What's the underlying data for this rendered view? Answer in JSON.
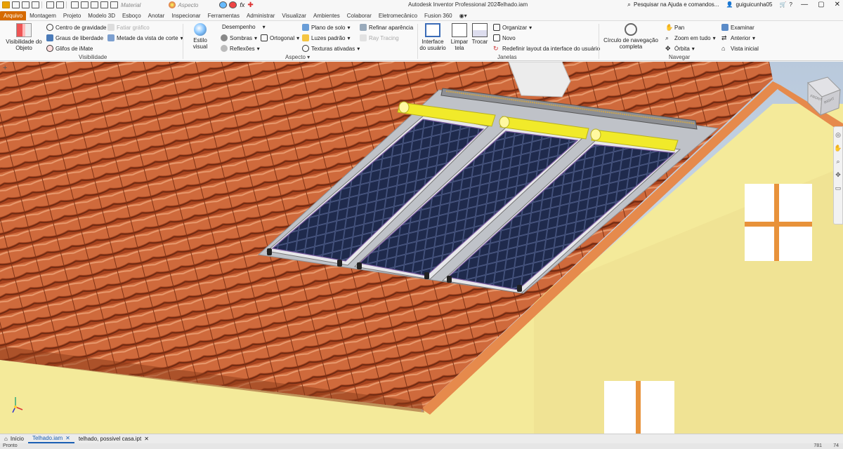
{
  "titlebar": {
    "material_placeholder": "Material",
    "appearance_placeholder": "Aspecto",
    "app_title": "Autodesk Inventor Professional 2024",
    "file_name": "Telhado.iam",
    "search_text": "Pesquisar na Ajuda e comandos...",
    "user_name": "guiguicunha05"
  },
  "tabs": [
    "Arquivo",
    "Montagem",
    "Projeto",
    "Modelo 3D",
    "Esboço",
    "Anotar",
    "Inspecionar",
    "Ferramentas",
    "Administrar",
    "Visualizar",
    "Ambientes",
    "Colaborar",
    "Eletromecânico",
    "Fusion 360"
  ],
  "ribbon": {
    "visibilidade": {
      "object_visibility": "Visibilidade do Objeto",
      "centro_gravidade": "Centro de gravidade",
      "graus_liberdade": "Graus de liberdade",
      "glifos_imate": "Glifos de iMate",
      "fatiar_grafico": "Fatiar gráfico",
      "metade_vista": "Metade da vista de corte",
      "label": "Visibilidade"
    },
    "aspecto": {
      "estilo_visual": "Estilo visual",
      "desempenho": "Desempenho",
      "sombras": "Sombras",
      "reflexoes": "Reflexões",
      "ortogonal": "Ortogonal",
      "plano_solo": "Plano de solo",
      "luzes_padrao": "Luzes padrão",
      "texturas_ativadas": "Texturas ativadas",
      "refinar_aparencia": "Refinar aparência",
      "ray_tracing": "Ray Tracing",
      "label": "Aspecto"
    },
    "janelas": {
      "interface_usuario": "Interface do usuário",
      "limpar_tela": "Limpar tela",
      "trocar": "Trocar",
      "organizar": "Organizar",
      "novo": "Novo",
      "redefinir_layout": "Redefinir layout da interface do usuário",
      "label": "Janelas"
    },
    "navegar": {
      "circulo_navegacao": "Círculo de navegação completa",
      "pan": "Pan",
      "zoom_tudo": "Zoom em tudo",
      "orbita": "Órbita",
      "examinar": "Examinar",
      "anterior": "Anterior",
      "vista_inicial": "Vista inicial",
      "label": "Navegar"
    }
  },
  "viewcube": {
    "face_front": "FRONT",
    "face_right": "RIGHT"
  },
  "doctabs": {
    "home": "Início",
    "tab1": "Telhado.iam",
    "tab2": "telhado, possivel casa.ipt"
  },
  "status": {
    "left": "Pronto",
    "right": "781",
    "right2": "74"
  },
  "colors": {
    "accent_tab": "#d66a00",
    "roof_tile": "#c0532a",
    "wall": "#f4ea9a",
    "panel": "#1b2340"
  }
}
